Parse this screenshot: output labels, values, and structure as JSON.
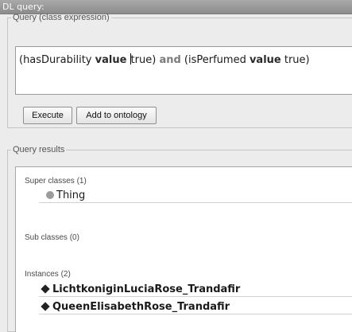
{
  "window": {
    "title": "DL query:"
  },
  "query_panel": {
    "legend": "Query (class expression)",
    "expression": {
      "part1": "(hasDurability ",
      "kw_value_1": "value",
      "part2_before_caret": " ",
      "part2_after_caret": "true) ",
      "kw_and": "and",
      "part3": " (isPerfumed ",
      "kw_value_2": "value",
      "part4": " true)"
    },
    "execute_label": "Execute",
    "add_to_ontology_label": "Add to ontology"
  },
  "results_panel": {
    "legend": "Query results",
    "super_classes": {
      "label": "Super classes (1)",
      "items": [
        {
          "name": "Thing",
          "icon": "class-circle-icon"
        }
      ]
    },
    "sub_classes": {
      "label": "Sub classes (0)",
      "items": []
    },
    "instances": {
      "label": "Instances (2)",
      "items": [
        {
          "name": "LichtkoniginLuciaRose_Trandafir",
          "icon": "individual-diamond-icon"
        },
        {
          "name": "QueenElisabethRose_Trandafir",
          "icon": "individual-diamond-icon"
        }
      ]
    }
  },
  "colors": {
    "titlebar": "#9a9a9a",
    "panel": "#ececec",
    "text_area": "#ffffff",
    "class_icon": "#9c9c9c",
    "individual_icon": "#222222"
  }
}
